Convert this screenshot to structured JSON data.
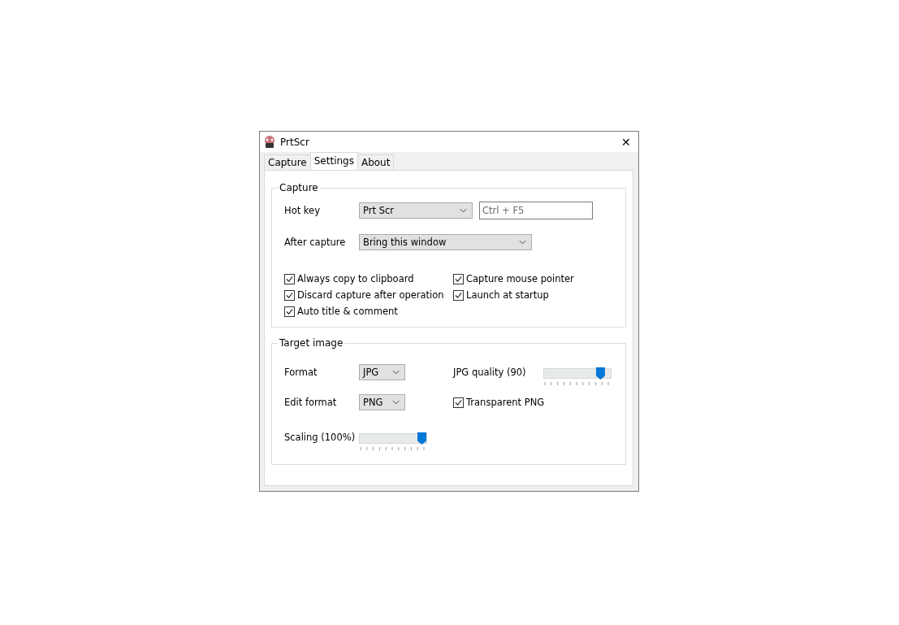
{
  "window": {
    "title": "PrtScr",
    "close": "✕"
  },
  "tabs": [
    {
      "label": "Capture",
      "selected": false
    },
    {
      "label": "Settings",
      "selected": true
    },
    {
      "label": "About",
      "selected": false
    }
  ],
  "capture": {
    "title": "Capture",
    "hot_key": {
      "label": "Hot key",
      "value": "Prt Scr",
      "field_value": "Ctrl + F5",
      "field_disabled": true
    },
    "after_capture": {
      "label": "After capture",
      "value": "Bring this window"
    },
    "options": [
      {
        "label": "Always copy to clipboard",
        "checked": true
      },
      {
        "label": "Capture mouse pointer",
        "checked": true
      },
      {
        "label": "Discard capture after operation",
        "checked": true
      },
      {
        "label": "Launch at startup",
        "checked": true
      },
      {
        "label": "Auto title & comment",
        "checked": true
      }
    ]
  },
  "target_image": {
    "title": "Target image",
    "format": {
      "label": "Format",
      "value": "JPG"
    },
    "edit_format": {
      "label": "Edit format",
      "value": "PNG"
    },
    "jpg_quality": {
      "label": "JPG quality (90)",
      "level": 0.9
    },
    "transparent_png": {
      "label": "Transparent PNG",
      "checked": true
    },
    "scaling": {
      "label": "Scaling (100%)",
      "level": 1.0
    }
  }
}
